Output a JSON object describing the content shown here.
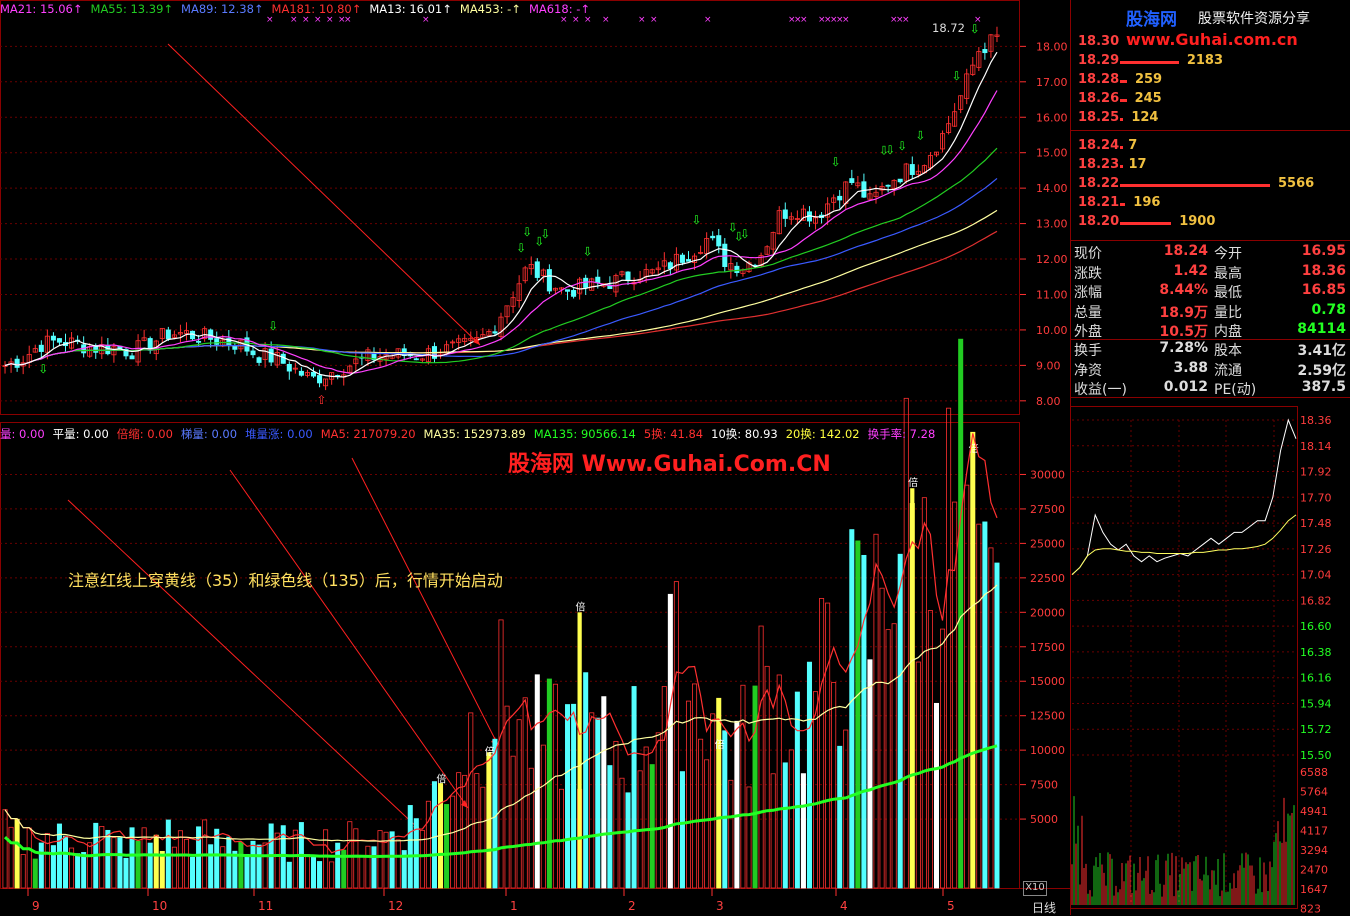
{
  "colors": {
    "background": "#000000",
    "grid": "#7a0000",
    "up": "#ff3030",
    "down": "#54ffff",
    "ma_white": "#ffffff",
    "ma_magenta": "#ff40ff",
    "ma_green": "#22cc22",
    "ma_blue": "#3a5aff",
    "ma_yellow": "#ffffa0",
    "ma_red": "#e03030"
  },
  "price_legend": [
    {
      "label": "MA21: 15.06",
      "color": "#ff40ff"
    },
    {
      "label": "MA55: 13.39",
      "color": "#22cc22"
    },
    {
      "label": "MA89: 12.38",
      "color": "#5a7aff"
    },
    {
      "label": "MA181: 10.80",
      "color": "#ff3030"
    },
    {
      "label": "MA13: 16.01",
      "color": "#ffffff"
    },
    {
      "label": "MA453: -",
      "color": "#ffffa0"
    },
    {
      "label": "MA618: -",
      "color": "#ff40ff"
    }
  ],
  "volume_legend": [
    {
      "label": "量: 0.00",
      "color": "#ff40ff"
    },
    {
      "label": "平量: 0.00",
      "color": "#ffffff"
    },
    {
      "label": "倍缩: 0.00",
      "color": "#ff3030"
    },
    {
      "label": "梯量: 0.00",
      "color": "#5a7aff"
    },
    {
      "label": "堆量涨: 0.00",
      "color": "#3a5aff"
    },
    {
      "label": "MA5: 217079.20",
      "color": "#ff3030"
    },
    {
      "label": "MA35: 152973.89",
      "color": "#ffffa0"
    },
    {
      "label": "MA135: 90566.14",
      "color": "#22ff22"
    },
    {
      "label": "5换: 41.84",
      "color": "#ff3030"
    },
    {
      "label": "10换: 80.93",
      "color": "#ffffff"
    },
    {
      "label": "20换: 142.02",
      "color": "#ffff40"
    },
    {
      "label": "换手率: 7.28",
      "color": "#ff40ff"
    }
  ],
  "peak_label": "18.72",
  "watermark_top": "股海网 Www.Guhai.Com.CN",
  "annotation": "注意红线上穿黄线（35）和绿色线（135）后，行情开始启动",
  "bei_marker": "倍",
  "logo": {
    "name": "股海网",
    "slogan": "股票软件资源分享",
    "url": "www.Guhai.com.cn"
  },
  "x_axis_months": [
    {
      "label": "9"
    },
    {
      "label": "10"
    },
    {
      "label": "11"
    },
    {
      "label": "12"
    },
    {
      "label": "1"
    },
    {
      "label": "2"
    },
    {
      "label": "3"
    },
    {
      "label": "4"
    },
    {
      "label": "5"
    }
  ],
  "x10_label": "X10",
  "period_label": "日线",
  "price_axis": [
    "18.00",
    "17.00",
    "16.00",
    "15.00",
    "14.00",
    "13.00",
    "12.00",
    "11.00",
    "10.00",
    "9.00",
    "8.00"
  ],
  "volume_axis": [
    "30000",
    "27500",
    "25000",
    "22500",
    "20000",
    "17500",
    "15000",
    "12500",
    "10000",
    "7500",
    "5000"
  ],
  "order_book": {
    "asks": [
      {
        "price": "18.30",
        "vol": ""
      },
      {
        "price": "18.29",
        "vol": "2183"
      },
      {
        "price": "18.28",
        "vol": "259"
      },
      {
        "price": "18.26",
        "vol": "245"
      },
      {
        "price": "18.25",
        "vol": "124"
      }
    ],
    "bids": [
      {
        "price": "18.24",
        "vol": "7"
      },
      {
        "price": "18.23",
        "vol": "17"
      },
      {
        "price": "18.22",
        "vol": "5566"
      },
      {
        "price": "18.21",
        "vol": "196"
      },
      {
        "price": "18.20",
        "vol": "1900"
      }
    ]
  },
  "stats": [
    {
      "l1": "现价",
      "v1": "18.24",
      "l2": "今开",
      "v2": "16.95"
    },
    {
      "l1": "涨跌",
      "v1": "1.42",
      "l2": "最高",
      "v2": "18.36"
    },
    {
      "l1": "涨幅",
      "v1": "8.44%",
      "l2": "最低",
      "v2": "16.85"
    },
    {
      "l1": "总量",
      "v1": "18.9万",
      "l2": "量比",
      "v2": "0.78"
    },
    {
      "l1": "外盘",
      "v1": "10.5万",
      "l2": "内盘",
      "v2": "84114"
    }
  ],
  "stats2": [
    {
      "l1": "换手",
      "v1": "7.28%",
      "l2": "股本",
      "v2": "3.41亿"
    },
    {
      "l1": "净资",
      "v1": "3.88",
      "l2": "流通",
      "v2": "2.59亿"
    },
    {
      "l1": "收益(一)",
      "v1": "0.012",
      "l2": "PE(动)",
      "v2": "387.5"
    }
  ],
  "intraday_price_axis": [
    "18.36",
    "18.14",
    "17.92",
    "17.70",
    "17.48",
    "17.26",
    "17.04",
    "16.82",
    "16.60",
    "16.38",
    "16.16",
    "15.94",
    "15.72",
    "15.50"
  ],
  "intraday_volume_axis": [
    "6588",
    "5764",
    "4941",
    "4117",
    "3294",
    "2470",
    "1647",
    "823"
  ],
  "chart_data": [
    {
      "type": "candlestick",
      "title": "",
      "ylim": [
        7.6,
        18.8
      ],
      "x_months": [
        "9",
        "10",
        "11",
        "12",
        "1",
        "2",
        "3",
        "4",
        "5"
      ],
      "series_description": "daily candles rising from ~9 to 18.72 peak with MA lines",
      "closes_sampled": [
        9.0,
        9.2,
        9.6,
        9.7,
        9.6,
        9.5,
        9.5,
        9.4,
        9.6,
        9.9,
        9.9,
        9.8,
        9.7,
        9.6,
        9.3,
        9.2,
        8.9,
        8.6,
        8.8,
        9.0,
        9.2,
        9.3,
        9.3,
        9.3,
        9.4,
        9.5,
        9.6,
        10.0,
        10.9,
        11.8,
        11.4,
        11.1,
        11.2,
        11.3,
        11.4,
        11.6,
        11.6,
        11.9,
        12.2,
        12.6,
        11.9,
        11.8,
        12.2,
        13.3,
        13.4,
        13.2,
        13.8,
        14.2,
        13.6,
        14.2,
        14.5,
        14.8,
        15.5,
        16.6,
        17.9,
        18.24
      ],
      "ma_lines": [
        "MA13",
        "MA21",
        "MA55",
        "MA89",
        "MA181",
        "MA453"
      ]
    },
    {
      "type": "bar",
      "title": "",
      "ylim": [
        0,
        32500
      ],
      "volumes_sampled": [
        4000,
        3400,
        3800,
        3500,
        3600,
        4200,
        3000,
        3300,
        3500,
        3800,
        3400,
        3600,
        3200,
        3500,
        3400,
        3300,
        3200,
        3500,
        3300,
        3400,
        3600,
        3800,
        4500,
        5200,
        7000,
        9000,
        12000,
        13500,
        14000,
        11000,
        10500,
        11000,
        12000,
        10000,
        10500,
        11000,
        12500,
        16000,
        14500,
        13500,
        11000,
        10500,
        15000,
        14000,
        12000,
        14500,
        16000,
        19000,
        18500,
        25000,
        26500,
        23000,
        24000,
        31000,
        20000,
        19000
      ],
      "ma_lines": [
        "MA5",
        "MA35",
        "MA135"
      ]
    }
  ]
}
